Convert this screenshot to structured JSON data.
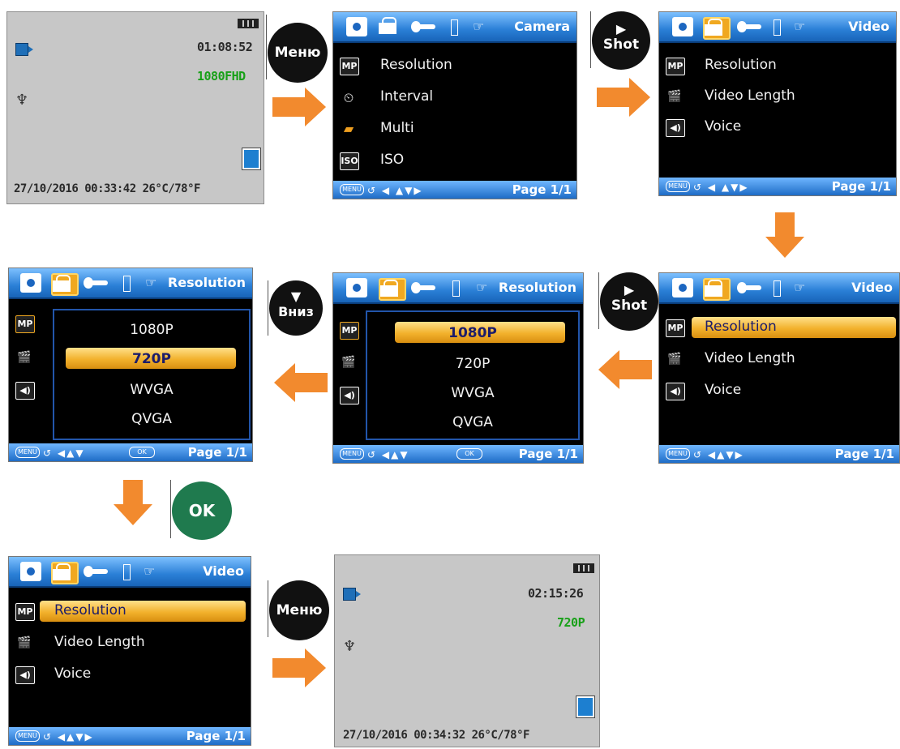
{
  "colors": {
    "menu_header": "#2a7fd6",
    "selection": "#f2b12c",
    "arrow": "#f28a2e",
    "ok_button": "#1f7a4e",
    "preview_bg": "#c7c7c7",
    "resolution_text": "#18a018"
  },
  "icons": [
    "camera-tab-icon",
    "video-tab-icon",
    "wrench-tab-icon",
    "battery-tab-icon",
    "hand-tab-icon",
    "mp-icon",
    "interval-icon",
    "multi-icon",
    "iso-icon",
    "video-length-icon",
    "voice-icon",
    "video-camera-icon",
    "microphone-icon",
    "sd-card-icon",
    "battery-icon"
  ],
  "labels": {
    "menu": "Меню",
    "shot": "Shot",
    "down": "Вниз",
    "ok": "OK",
    "menu_btn": "MENU",
    "ok_btn": "OK"
  },
  "screen1": {
    "time": "01:08:52",
    "resolution": "1080FHD",
    "footer": "27/10/2016  00:33:42  26°C/78°F"
  },
  "screen2": {
    "title": "Camera",
    "items": [
      "Resolution",
      "Interval",
      "Multi",
      "ISO"
    ],
    "page": "Page  1/1"
  },
  "screen3": {
    "title": "Video",
    "items": [
      "Resolution",
      "Video Length",
      "Voice"
    ],
    "page": "Page  1/1"
  },
  "screen4": {
    "title": "Video",
    "items": [
      "Resolution",
      "Video Length",
      "Voice"
    ],
    "page": "Page  1/1"
  },
  "screen5": {
    "title": "Resolution",
    "options": [
      "1080P",
      "720P",
      "WVGA",
      "QVGA"
    ],
    "page": "Page  1/1"
  },
  "screen6": {
    "title": "Resolution",
    "options": [
      "1080P",
      "720P",
      "WVGA",
      "QVGA"
    ],
    "page": "Page  1/1"
  },
  "screen7": {
    "title": "Video",
    "items": [
      "Resolution",
      "Video Length",
      "Voice"
    ],
    "page": "Page  1/1"
  },
  "screen8": {
    "time": "02:15:26",
    "resolution": "720P",
    "footer": "27/10/2016  00:34:32  26°C/78°F"
  }
}
